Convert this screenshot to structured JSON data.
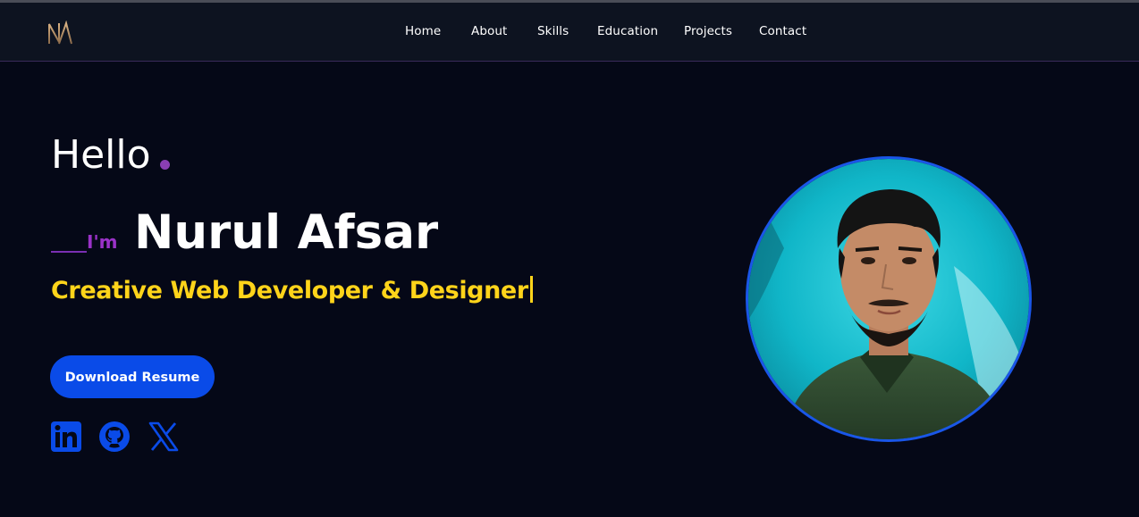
{
  "brand": {
    "logo_text": "NAF",
    "logo_colors": [
      "#c8a072",
      "#8a6a4a"
    ]
  },
  "nav": {
    "items": [
      {
        "label": "Home"
      },
      {
        "label": "About"
      },
      {
        "label": "Skills"
      },
      {
        "label": "Education"
      },
      {
        "label": "Projects"
      },
      {
        "label": "Contact"
      }
    ]
  },
  "hero": {
    "greeting": "Hello",
    "intro": "I'm",
    "name": "Nurul Afsar",
    "tagline": "Creative Web Developer & Designer",
    "resume_button": "Download Resume"
  },
  "social": [
    {
      "icon": "linkedin-icon"
    },
    {
      "icon": "github-icon"
    },
    {
      "icon": "x-icon"
    }
  ],
  "avatar": {
    "icon": "profile-photo"
  },
  "colors": {
    "background": "#050817",
    "navbar": "#0d1320",
    "accent_blue": "#0a4be8",
    "accent_purple": "#9a32c8",
    "tagline_yellow": "#ffd41a",
    "avatar_border": "#1a56e8"
  }
}
